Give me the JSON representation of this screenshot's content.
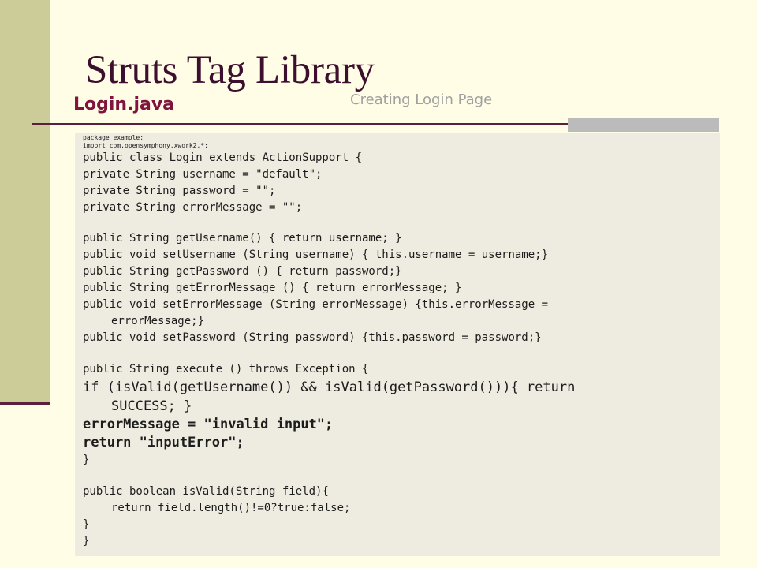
{
  "slide": {
    "title": "Struts Tag Library",
    "subtitle": "Login.java",
    "section_note": "Creating Login Page"
  },
  "code": {
    "l1": "package example;",
    "l2": "import com.opensymphony.xwork2.*;",
    "l3": "public class Login extends ActionSupport {",
    "l4": "private String username = \"default\";",
    "l5": "private String password = \"\";",
    "l6": "private String errorMessage = \"\";",
    "l7": "public String getUsername() { return username; }",
    "l8": "public void setUsername (String username) { this.username = username;}",
    "l9": "public String getPassword () { return password;}",
    "l10": "public String getErrorMessage () { return errorMessage; }",
    "l11a": "public void setErrorMessage (String errorMessage) {this.errorMessage =",
    "l11b": "errorMessage;}",
    "l12": "public void setPassword (String password) {this.password = password;}",
    "l13": "public String execute () throws Exception {",
    "l14a": "if (isValid(getUsername()) && isValid(getPassword())){ return",
    "l14b": "SUCCESS; }",
    "l15": "errorMessage = \"invalid input\";",
    "l16": "return \"inputError\";",
    "l17": "}",
    "l18": "public boolean isValid(String field){",
    "l19": "return field.length()!=0?true:false;",
    "l20": "}",
    "l21": "}"
  },
  "colors": {
    "background": "#fffde6",
    "left_bar": "#cccc99",
    "title": "#3d0f2f",
    "subtitle": "#80143e",
    "code_panel": "#eeebe0"
  }
}
